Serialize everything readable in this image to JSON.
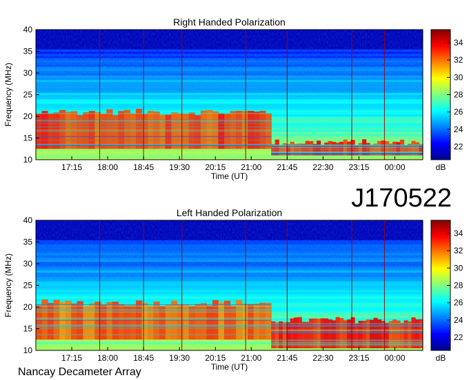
{
  "observatory": "Nancay Decameter Array",
  "observation_id": "J170522",
  "colors": {
    "colormap": [
      "#00008f",
      "#0000ff",
      "#0080ff",
      "#00ffff",
      "#80ff80",
      "#ffff00",
      "#ff8000",
      "#ff0000",
      "#800000"
    ]
  },
  "chart_data": [
    {
      "type": "heatmap",
      "title": "Right Handed Polarization",
      "xlabel": "Time (UT)",
      "ylabel": "Frequency (MHz)",
      "x_ticks": [
        "17:15",
        "18:00",
        "18:45",
        "19:30",
        "20:15",
        "21:00",
        "21:45",
        "22:30",
        "23:15",
        "00:00"
      ],
      "x_tick_minutes": [
        1035,
        1080,
        1125,
        1170,
        1215,
        1260,
        1305,
        1350,
        1395,
        1440
      ],
      "xlim_minutes": [
        990,
        1475
      ],
      "y_ticks": [
        10,
        15,
        20,
        25,
        30,
        35,
        40
      ],
      "ylim": [
        10,
        40
      ],
      "colorbar": {
        "label": "dB",
        "ticks": [
          22,
          24,
          26,
          28,
          30,
          32,
          34
        ],
        "range": [
          20.5,
          35.5
        ]
      },
      "emission_bands": [
        {
          "t_start": 990,
          "t_end": 1285,
          "f_low": 12.5,
          "f_high": 21,
          "level_db": 33.5
        },
        {
          "t_start": 1285,
          "t_end": 1475,
          "f_low": 11,
          "f_high": 14,
          "level_db": 34
        }
      ]
    },
    {
      "type": "heatmap",
      "title": "Left Handed Polarization",
      "xlabel": "Time (UT)",
      "ylabel": "Frequency (MHz)",
      "x_ticks": [
        "17:15",
        "18:00",
        "18:45",
        "19:30",
        "20:15",
        "21:00",
        "21:45",
        "22:30",
        "23:15",
        "00:00"
      ],
      "x_tick_minutes": [
        1035,
        1080,
        1125,
        1170,
        1215,
        1260,
        1305,
        1350,
        1395,
        1440
      ],
      "xlim_minutes": [
        990,
        1475
      ],
      "y_ticks": [
        10,
        15,
        20,
        25,
        30,
        35,
        40
      ],
      "ylim": [
        10,
        40
      ],
      "colorbar": {
        "label": "dB",
        "ticks": [
          22,
          24,
          26,
          28,
          30,
          32,
          34
        ],
        "range": [
          20.5,
          35.5
        ]
      },
      "emission_bands": [
        {
          "t_start": 990,
          "t_end": 1285,
          "f_low": 12.5,
          "f_high": 21,
          "level_db": 33
        },
        {
          "t_start": 1285,
          "t_end": 1475,
          "f_low": 10.5,
          "f_high": 17,
          "level_db": 34
        }
      ]
    }
  ]
}
